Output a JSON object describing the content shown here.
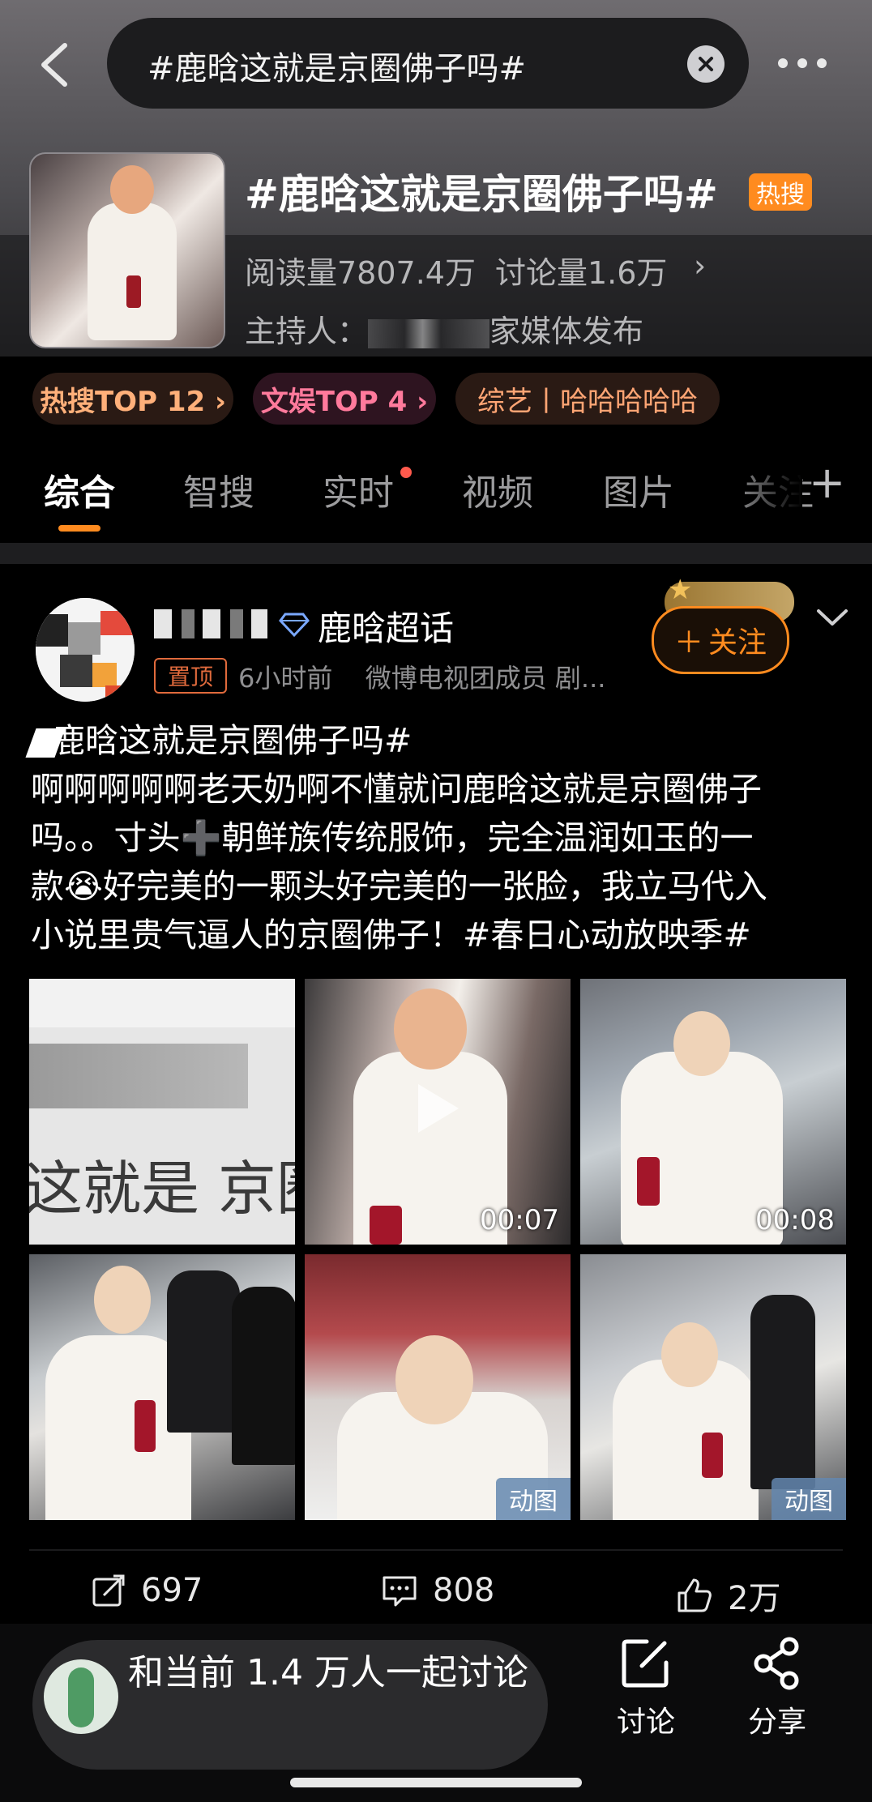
{
  "header": {
    "search_query": "#鹿晗这就是京圈佛子吗#",
    "topic_title": "#鹿晗这就是京圈佛子吗#",
    "hot_badge": "热搜",
    "reads": "阅读量7807.4万",
    "discussions": "讨论量1.6万",
    "host_label": "主持人：",
    "host_suffix": "家媒体发布"
  },
  "chips": [
    {
      "label": "热搜TOP 12 ›"
    },
    {
      "label": "文娱TOP 4 ›"
    },
    {
      "label": "综艺丨哈哈哈哈哈"
    }
  ],
  "tabs": [
    {
      "label": "综合"
    },
    {
      "label": "智搜"
    },
    {
      "label": "实时"
    },
    {
      "label": "视频"
    },
    {
      "label": "图片"
    },
    {
      "label": "关注"
    }
  ],
  "post": {
    "supertopic": "鹿晗超话",
    "pin_badge": "置顶",
    "time": "6小时前",
    "source": "微博电视团成员 剧...",
    "follow_label": "关注",
    "body_lines": [
      "鹿晗这就是京圈佛子吗#",
      "啊啊啊啊啊老天奶啊不懂就问鹿晗这就是京圈佛子",
      "吗。。寸头➕朝鲜族传统服饰，完全温润如玉的一",
      "款😭好完美的一颗头好完美的一张脸，我立马代入",
      "小说里贵气逼人的京圈佛子！#春日心动放映季#"
    ],
    "images": [
      {
        "overlay_text": "这就是 京圈",
        "kind": "image"
      },
      {
        "duration": "00:07",
        "kind": "video"
      },
      {
        "duration": "00:08",
        "kind": "video"
      },
      {
        "kind": "image"
      },
      {
        "badge": "动图",
        "kind": "gif"
      },
      {
        "badge": "动图",
        "kind": "gif"
      }
    ],
    "reposts": "697",
    "comments": "808",
    "likes": "2万"
  },
  "bottom": {
    "discuss_prompt": "和当前 1.4 万人一起讨论",
    "discuss_label": "讨论",
    "share_label": "分享"
  },
  "colors": {
    "accent": "#ff8b1f",
    "hot": "#ff8b1f",
    "chip_hot_text": "#ffb07a",
    "chip_ent_text": "#ff7a9c"
  }
}
